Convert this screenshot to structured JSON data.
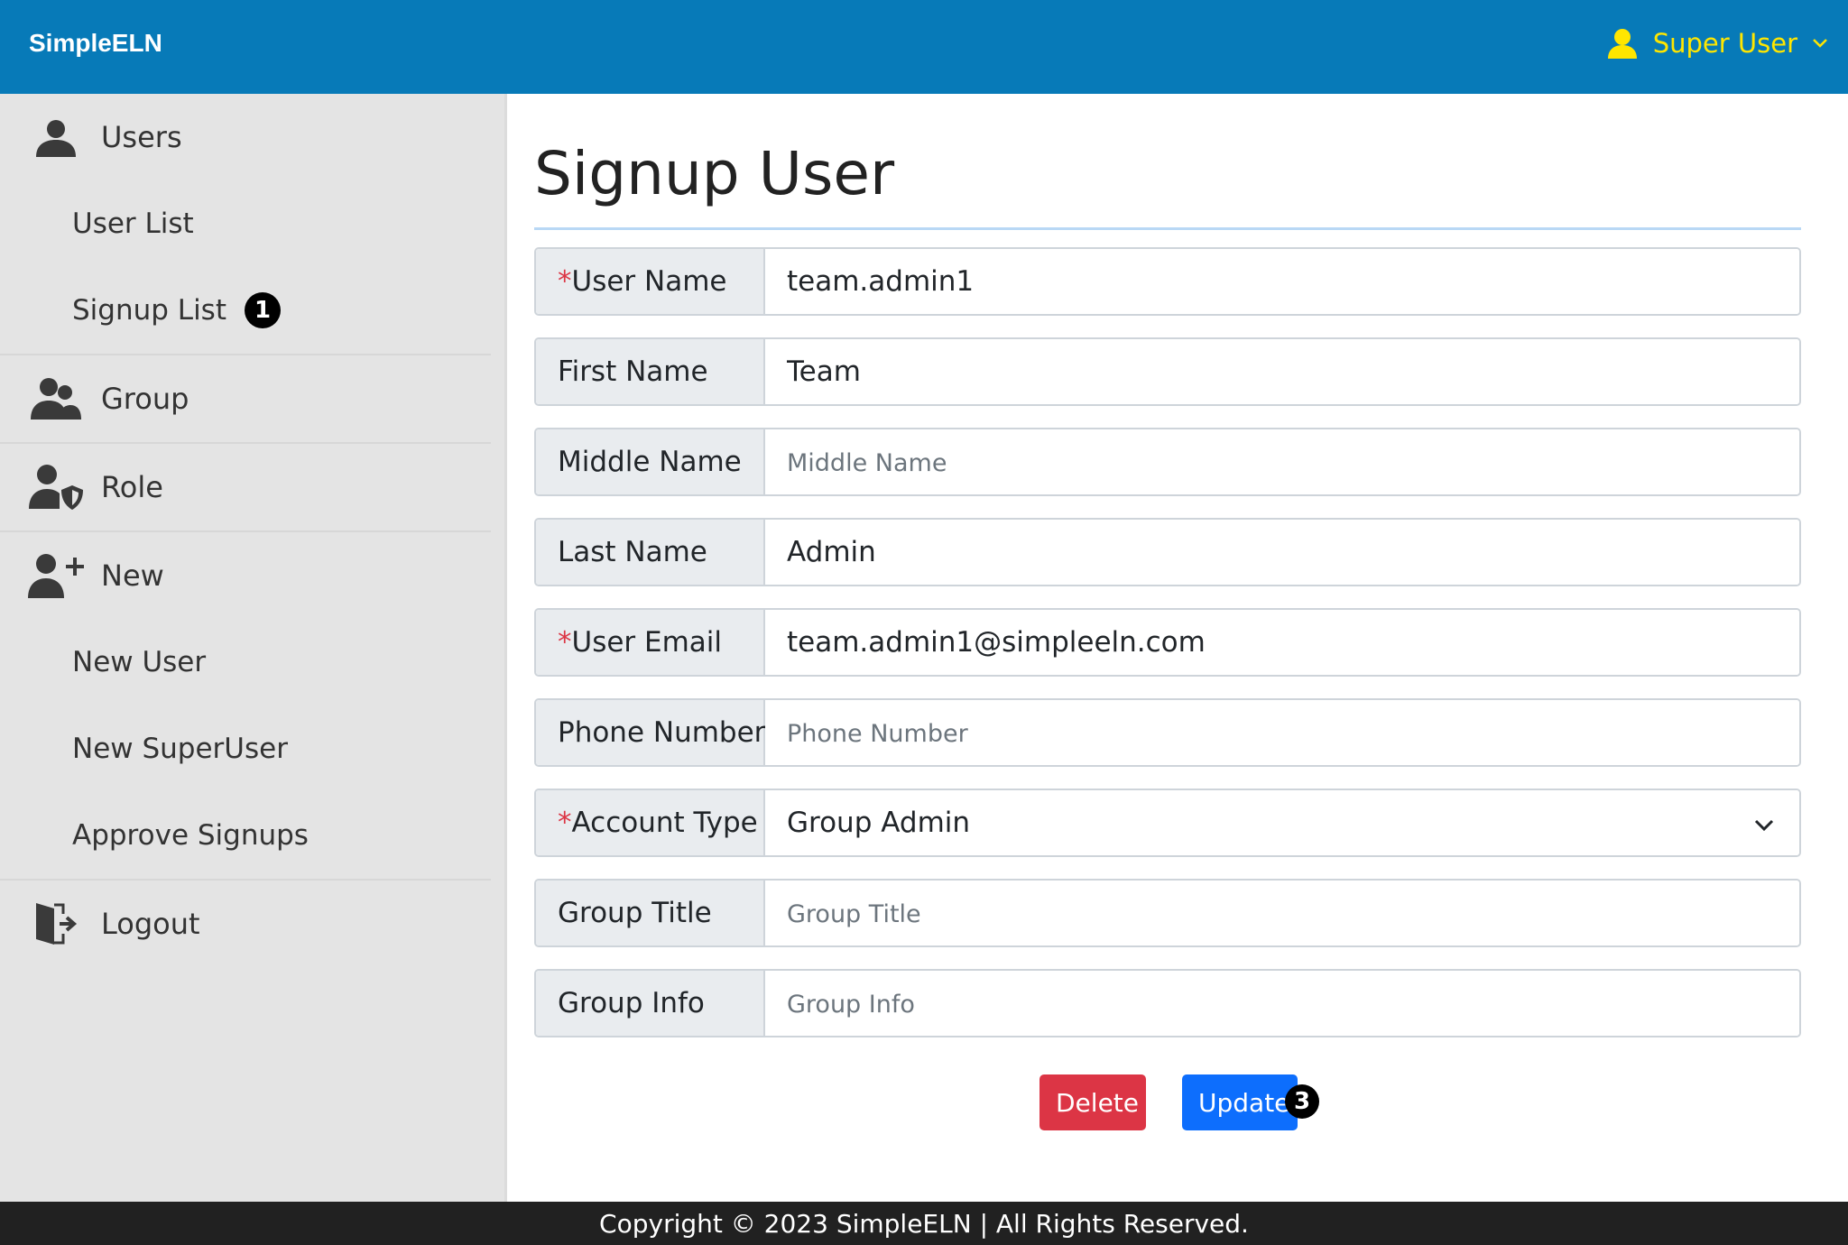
{
  "app": {
    "brand": "SimpleELN"
  },
  "user_menu": {
    "name": "Super User"
  },
  "sidebar": {
    "users": {
      "label": "Users",
      "items": [
        {
          "label": "User List"
        },
        {
          "label": "Signup List",
          "badge": "1"
        }
      ]
    },
    "group": {
      "label": "Group"
    },
    "role": {
      "label": "Role"
    },
    "new": {
      "label": "New",
      "items": [
        {
          "label": "New User"
        },
        {
          "label": "New SuperUser"
        },
        {
          "label": "Approve Signups"
        }
      ]
    },
    "logout": {
      "label": "Logout"
    }
  },
  "form": {
    "title": "Signup User",
    "required_mark": "*",
    "fields": [
      {
        "label": "User Name",
        "required": true,
        "value": "team.admin1",
        "placeholder": ""
      },
      {
        "label": "First Name",
        "required": false,
        "value": "Team",
        "placeholder": ""
      },
      {
        "label": "Middle Name",
        "required": false,
        "value": "",
        "placeholder": "Middle Name"
      },
      {
        "label": "Last Name",
        "required": false,
        "value": "Admin",
        "placeholder": ""
      },
      {
        "label": "User Email",
        "required": true,
        "value": "team.admin1@simpleeln.com",
        "placeholder": ""
      },
      {
        "label": "Phone Number",
        "required": false,
        "value": "",
        "placeholder": "Phone Number"
      },
      {
        "label": "Account Type",
        "required": true,
        "value": "Group Admin",
        "type": "select"
      },
      {
        "label": "Group Title",
        "required": false,
        "value": "",
        "placeholder": "Group Title"
      },
      {
        "label": "Group Info",
        "required": false,
        "value": "",
        "placeholder": "Group Info"
      }
    ],
    "delete_label": "Delete",
    "update_label": "Update",
    "update_badge": "3"
  },
  "footer": {
    "text": "Copyright © 2023 SimpleELN | All Rights Reserved."
  },
  "colors": {
    "topbar": "#077ab8",
    "user_accent": "#ffe600",
    "delete": "#dc3545",
    "update": "#0d6efd",
    "sidebar": "#e4e4e4",
    "footer": "#212121"
  },
  "icons": [
    "user-icon",
    "chevron-down-icon",
    "users-icon",
    "group-icon",
    "role-shield-icon",
    "user-plus-icon",
    "logout-icon"
  ]
}
